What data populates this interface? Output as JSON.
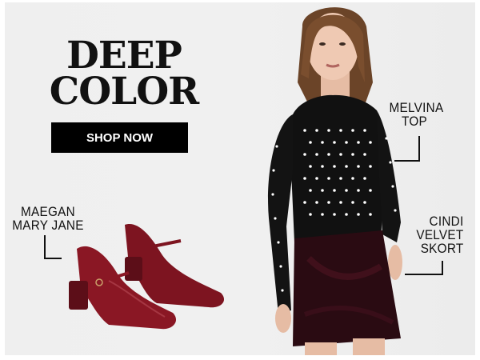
{
  "banner": {
    "headline": [
      "DEEP",
      "COLOR"
    ],
    "cta_label": "SHOP NOW"
  },
  "callouts": {
    "top": [
      "MELVINA",
      "TOP"
    ],
    "skort": [
      "CINDI",
      "VELVET",
      "SKORT"
    ],
    "shoe": [
      "MAEGAN",
      "MARY JANE"
    ]
  },
  "colors": {
    "background": "#efefef",
    "cta_bg": "#000000",
    "cta_text": "#ffffff",
    "shoe": "#7d1420",
    "skort": "#2a0b12"
  }
}
